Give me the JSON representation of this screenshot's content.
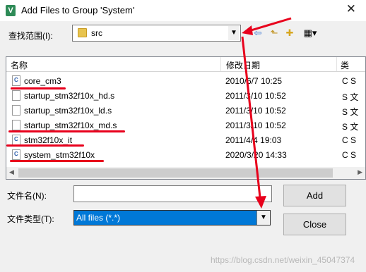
{
  "window": {
    "title": "Add Files to Group 'System'",
    "app_icon_glyph": "V",
    "close_glyph": "✕"
  },
  "look_in": {
    "label": "查找范围(I):",
    "value": "src"
  },
  "toolbar_icons": [
    "back-arrow-icon",
    "up-folder-icon",
    "new-folder-icon",
    "view-menu-icon"
  ],
  "columns": {
    "name": "名称",
    "modified": "修改日期",
    "type": "类"
  },
  "files": [
    {
      "name": "core_cm3",
      "date": "2010/6/7 10:25",
      "type": "C S",
      "icon": "c-source-icon"
    },
    {
      "name": "startup_stm32f10x_hd.s",
      "date": "2011/3/10 10:52",
      "type": "S 文",
      "icon": "file-icon"
    },
    {
      "name": "startup_stm32f10x_ld.s",
      "date": "2011/3/10 10:52",
      "type": "S 文",
      "icon": "file-icon"
    },
    {
      "name": "startup_stm32f10x_md.s",
      "date": "2011/3/10 10:52",
      "type": "S 文",
      "icon": "file-icon"
    },
    {
      "name": "stm32f10x_it",
      "date": "2011/4/4 19:03",
      "type": "C S",
      "icon": "c-source-icon"
    },
    {
      "name": "system_stm32f10x",
      "date": "2020/3/20 14:33",
      "type": "C S",
      "icon": "c-source-icon"
    }
  ],
  "file_name": {
    "label": "文件名(N):",
    "value": ""
  },
  "file_type": {
    "label": "文件类型(T):",
    "value": "All files (*.*)"
  },
  "buttons": {
    "add": "Add",
    "close": "Close"
  },
  "watermark": "https://blog.csdn.net/weixin_45047374",
  "colors": {
    "annotation": "#e8001c",
    "selection": "#0078d7"
  }
}
